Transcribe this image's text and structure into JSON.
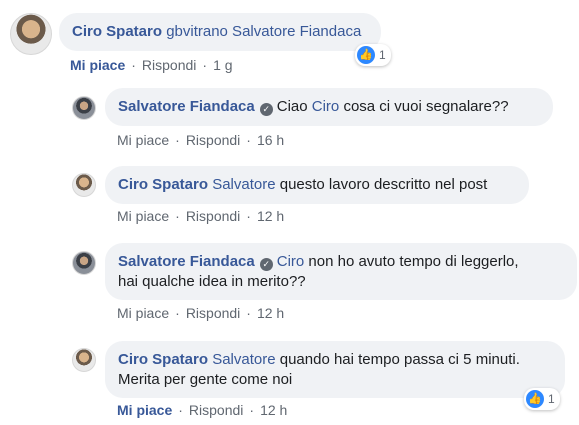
{
  "comments": [
    {
      "author": "Ciro Spataro",
      "mentions": "gbvitrano Salvatore Fiandaca",
      "text": "",
      "like_label": "Mi piace",
      "reply_label": "Rispondi",
      "time": "1 g",
      "reactions": "1"
    },
    {
      "author": "Salvatore Fiandaca",
      "text_before": "Ciao ",
      "mention": "Ciro",
      "text_after": " cosa ci vuoi segnalare??",
      "like_label": "Mi piace",
      "reply_label": "Rispondi",
      "time": "16 h"
    },
    {
      "author": "Ciro Spataro",
      "mention": "Salvatore",
      "text_after": " questo lavoro descritto nel post",
      "like_label": "Mi piace",
      "reply_label": "Rispondi",
      "time": "12 h"
    },
    {
      "author": "Salvatore Fiandaca",
      "mention": "Ciro",
      "text_after": " non ho avuto tempo di leggerlo,",
      "text_line2": "hai qualche idea in merito??",
      "like_label": "Mi piace",
      "reply_label": "Rispondi",
      "time": "12 h"
    },
    {
      "author": "Ciro Spataro",
      "mention": "Salvatore",
      "text_after": " quando hai tempo passa ci 5 minuti.",
      "text_line2": "Merita per gente come noi",
      "like_label": "Mi piace",
      "reply_label": "Rispondi",
      "time": "12 h",
      "reactions": "1"
    }
  ],
  "separator": "·",
  "icons": {
    "verified": "verified-badge-icon",
    "reaction": "like-thumb-icon"
  },
  "colors": {
    "link": "#385898",
    "bubble": "#f0f2f5",
    "reaction": "#2d88ff"
  }
}
